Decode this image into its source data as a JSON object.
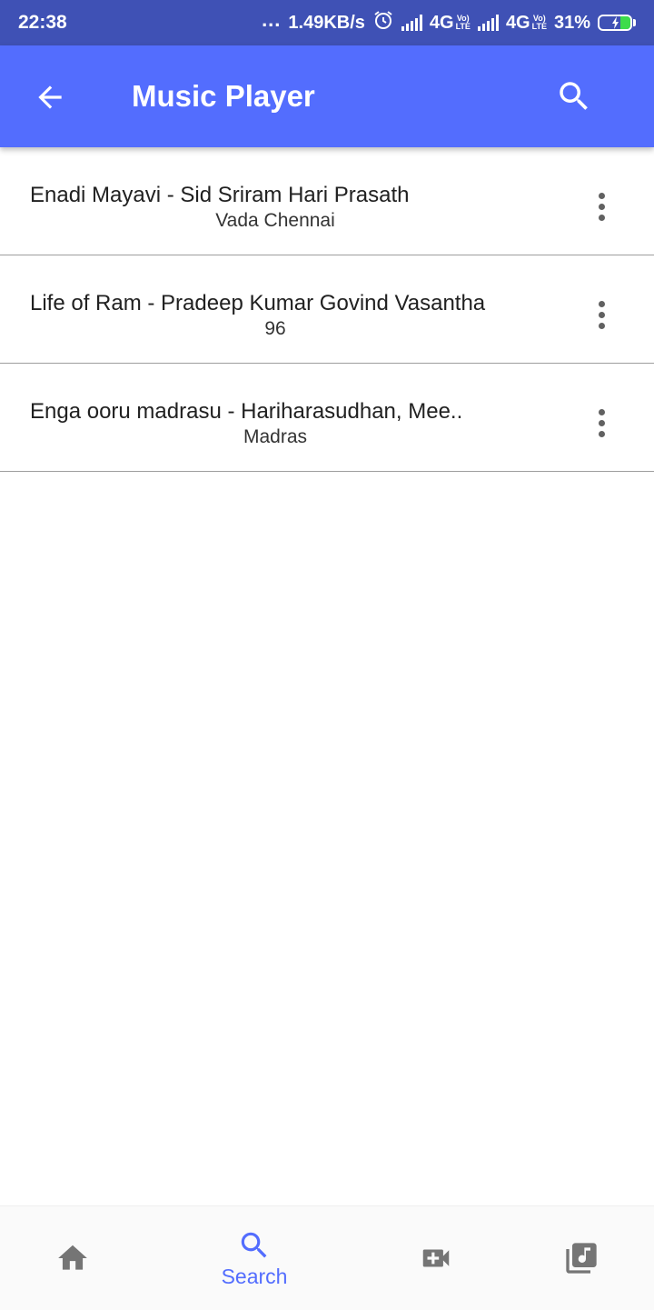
{
  "status_bar": {
    "time": "22:38",
    "dots": "...",
    "speed": "1.49KB/s",
    "net1": "4G",
    "volte1": [
      "Vo)",
      "LTE"
    ],
    "net2": "4G",
    "volte2": [
      "Vo)",
      "LTE"
    ],
    "battery": "31%",
    "battery_level": 0.31
  },
  "app_bar": {
    "title": "Music Player",
    "back_icon": "arrow-back-icon",
    "search_icon": "search-icon"
  },
  "songs": [
    {
      "title": "Enadi Mayavi - Sid Sriram Hari Prasath",
      "album": "Vada Chennai"
    },
    {
      "title": "Life of Ram - Pradeep Kumar Govind Vasantha",
      "album": "96"
    },
    {
      "title": "Enga ooru madrasu -  Hariharasudhan, Mee..",
      "album": "Madras"
    }
  ],
  "bottom_nav": {
    "items": [
      {
        "icon": "home-icon",
        "label": ""
      },
      {
        "icon": "search-icon",
        "label": "Search",
        "active": true
      },
      {
        "icon": "video-add-icon",
        "label": ""
      },
      {
        "icon": "music-library-icon",
        "label": ""
      }
    ],
    "active_color": "#536dfe",
    "inactive_color": "#757575"
  },
  "colors": {
    "status_bar": "#3f51b5",
    "app_bar": "#536dfe",
    "divider": "#9e9e9e"
  }
}
